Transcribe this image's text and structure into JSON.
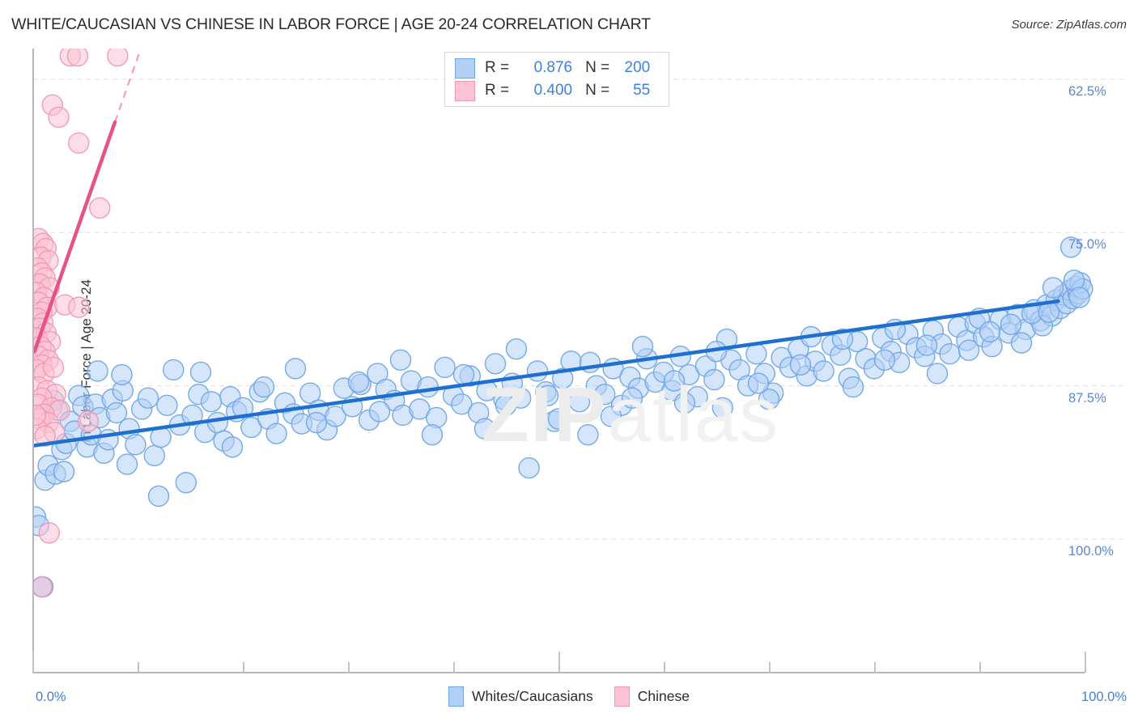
{
  "header": {
    "title": "WHITE/CAUCASIAN VS CHINESE IN LABOR FORCE | AGE 20-24 CORRELATION CHART",
    "source": "Source: ZipAtlas.com"
  },
  "watermark": {
    "part1": "ZIP",
    "part2": "atlas"
  },
  "legend": {
    "rows": [
      {
        "swatch": "blue",
        "r_key": "R =",
        "r_value": "0.876",
        "n_key": "N =",
        "n_value": "200"
      },
      {
        "swatch": "pink",
        "r_key": "R =",
        "r_value": "0.400",
        "n_key": "N =",
        "n_value": "55"
      }
    ]
  },
  "bottom_legend": {
    "items": [
      {
        "swatch": "blue",
        "label": "Whites/Caucasians"
      },
      {
        "swatch": "pink",
        "label": "Chinese"
      }
    ]
  },
  "axes": {
    "ylabel": "In Labor Force | Age 20-24",
    "y_ticks": [
      "100.0%",
      "87.5%",
      "75.0%",
      "62.5%"
    ],
    "x_start": "0.0%",
    "x_end": "100.0%"
  },
  "colors": {
    "blue_fill": "#b2cff6",
    "blue_stroke": "#6fa5e8",
    "blue_line": "#1f6fd0",
    "pink_fill": "#fcc3d4",
    "pink_stroke": "#f297b4",
    "pink_line": "#e8508a",
    "axis": "#b6b6b6",
    "grid": "#e3dede",
    "tick_text": "#3f7fe0",
    "title_text": "#2b2b2b"
  },
  "chart_data": {
    "type": "scatter",
    "title": "WHITE/CAUCASIAN VS CHINESE IN LABOR FORCE | AGE 20-24 CORRELATION CHART",
    "xlabel": "",
    "ylabel": "In Labor Force | Age 20-24",
    "xlim": [
      0,
      100
    ],
    "ylim": [
      52.0,
      102.5
    ],
    "x_ticks": [
      0,
      10,
      20,
      30,
      40,
      50,
      60,
      70,
      80,
      90,
      100
    ],
    "y_ticks": [
      62.5,
      75.0,
      87.5,
      100.0
    ],
    "grid": "horizontal-dashed",
    "legend_position": "top-center-box",
    "series": [
      {
        "name": "Whites/Caucasians",
        "color": "#b2cff6",
        "r": 0.876,
        "n": 200,
        "trendline": {
          "x0": 0,
          "y0": 70.1,
          "x1": 97.5,
          "y1": 81.9,
          "color": "#1f6fd0"
        },
        "points": [
          [
            0.3,
            64.3
          ],
          [
            0.6,
            63.6
          ],
          [
            0.9,
            58.6
          ],
          [
            1.2,
            67.3
          ],
          [
            1.5,
            68.5
          ],
          [
            2.0,
            73.8
          ],
          [
            2.4,
            73.0
          ],
          [
            2.8,
            69.8
          ],
          [
            3.2,
            70.3
          ],
          [
            3.6,
            72.1
          ],
          [
            4.0,
            71.3
          ],
          [
            4.4,
            74.2
          ],
          [
            4.8,
            73.3
          ],
          [
            5.2,
            70.0
          ],
          [
            5.6,
            71.0
          ],
          [
            6.0,
            73.5
          ],
          [
            6.4,
            72.4
          ],
          [
            6.8,
            69.5
          ],
          [
            7.2,
            70.6
          ],
          [
            7.6,
            73.9
          ],
          [
            8.0,
            72.8
          ],
          [
            8.6,
            74.6
          ],
          [
            9.2,
            71.5
          ],
          [
            9.8,
            70.2
          ],
          [
            10.4,
            73.1
          ],
          [
            11.0,
            74.0
          ],
          [
            11.6,
            69.3
          ],
          [
            12.2,
            70.8
          ],
          [
            12.8,
            73.4
          ],
          [
            13.4,
            76.3
          ],
          [
            14.0,
            71.8
          ],
          [
            14.6,
            67.1
          ],
          [
            15.2,
            72.6
          ],
          [
            15.8,
            74.3
          ],
          [
            16.4,
            71.2
          ],
          [
            17.0,
            73.7
          ],
          [
            17.6,
            72.0
          ],
          [
            18.2,
            70.5
          ],
          [
            18.8,
            74.1
          ],
          [
            19.4,
            72.9
          ],
          [
            20.0,
            73.2
          ],
          [
            20.8,
            71.6
          ],
          [
            21.6,
            74.5
          ],
          [
            22.4,
            72.3
          ],
          [
            23.2,
            71.1
          ],
          [
            24.0,
            73.6
          ],
          [
            24.8,
            72.7
          ],
          [
            25.6,
            71.9
          ],
          [
            26.4,
            74.4
          ],
          [
            27.2,
            73.0
          ],
          [
            28.0,
            71.4
          ],
          [
            28.8,
            72.5
          ],
          [
            29.6,
            74.8
          ],
          [
            30.4,
            73.3
          ],
          [
            31.2,
            75.1
          ],
          [
            32.0,
            72.2
          ],
          [
            32.8,
            76.0
          ],
          [
            33.6,
            74.7
          ],
          [
            34.4,
            73.8
          ],
          [
            35.2,
            72.6
          ],
          [
            36.0,
            75.4
          ],
          [
            36.8,
            73.1
          ],
          [
            37.6,
            74.9
          ],
          [
            38.4,
            72.4
          ],
          [
            39.2,
            76.5
          ],
          [
            40.0,
            74.2
          ],
          [
            40.8,
            73.5
          ],
          [
            41.6,
            75.8
          ],
          [
            42.4,
            72.8
          ],
          [
            43.2,
            74.6
          ],
          [
            44.0,
            76.8
          ],
          [
            44.8,
            73.9
          ],
          [
            45.6,
            75.2
          ],
          [
            46.4,
            74.0
          ],
          [
            47.2,
            68.3
          ],
          [
            48.0,
            76.2
          ],
          [
            48.8,
            74.5
          ],
          [
            49.6,
            72.1
          ],
          [
            50.4,
            75.6
          ],
          [
            51.2,
            77.0
          ],
          [
            52.0,
            73.7
          ],
          [
            52.8,
            71.0
          ],
          [
            53.6,
            75.0
          ],
          [
            54.4,
            74.3
          ],
          [
            55.2,
            76.4
          ],
          [
            56.0,
            73.4
          ],
          [
            56.8,
            75.7
          ],
          [
            57.6,
            74.8
          ],
          [
            58.4,
            77.2
          ],
          [
            59.2,
            75.3
          ],
          [
            60.0,
            76.1
          ],
          [
            60.8,
            74.6
          ],
          [
            61.6,
            77.4
          ],
          [
            62.4,
            75.9
          ],
          [
            63.2,
            74.1
          ],
          [
            64.0,
            76.6
          ],
          [
            64.8,
            75.5
          ],
          [
            65.6,
            73.2
          ],
          [
            66.4,
            77.1
          ],
          [
            67.2,
            76.3
          ],
          [
            68.0,
            75.0
          ],
          [
            68.8,
            77.6
          ],
          [
            69.6,
            76.0
          ],
          [
            70.4,
            74.4
          ],
          [
            71.2,
            77.3
          ],
          [
            72.0,
            76.5
          ],
          [
            72.8,
            78.0
          ],
          [
            73.6,
            75.8
          ],
          [
            74.4,
            77.0
          ],
          [
            75.2,
            76.2
          ],
          [
            76.0,
            78.3
          ],
          [
            76.8,
            77.5
          ],
          [
            77.6,
            75.6
          ],
          [
            78.4,
            78.6
          ],
          [
            79.2,
            77.2
          ],
          [
            80.0,
            76.4
          ],
          [
            80.8,
            78.9
          ],
          [
            81.6,
            77.8
          ],
          [
            82.4,
            76.9
          ],
          [
            83.2,
            79.2
          ],
          [
            84.0,
            78.1
          ],
          [
            84.8,
            77.4
          ],
          [
            85.6,
            79.5
          ],
          [
            86.4,
            78.4
          ],
          [
            87.2,
            77.6
          ],
          [
            88.0,
            79.8
          ],
          [
            88.8,
            78.7
          ],
          [
            89.6,
            80.1
          ],
          [
            90.4,
            79.0
          ],
          [
            91.2,
            78.2
          ],
          [
            92.0,
            80.4
          ],
          [
            92.8,
            79.3
          ],
          [
            93.6,
            80.8
          ],
          [
            94.4,
            79.6
          ],
          [
            95.2,
            81.2
          ],
          [
            95.8,
            80.3
          ],
          [
            96.4,
            81.6
          ],
          [
            96.9,
            80.7
          ],
          [
            97.3,
            82.0
          ],
          [
            97.7,
            81.3
          ],
          [
            98.0,
            82.4
          ],
          [
            98.3,
            81.7
          ],
          [
            98.6,
            82.8
          ],
          [
            98.9,
            82.1
          ],
          [
            99.2,
            83.1
          ],
          [
            99.4,
            82.5
          ],
          [
            99.6,
            83.4
          ],
          [
            99.8,
            82.9
          ],
          [
            98.7,
            86.3
          ],
          [
            8.5,
            75.9
          ],
          [
            12.0,
            66.0
          ],
          [
            25.0,
            76.4
          ],
          [
            2.2,
            67.8
          ],
          [
            3.0,
            68.0
          ],
          [
            1.0,
            58.6
          ],
          [
            35.0,
            77.1
          ],
          [
            38.0,
            71.0
          ],
          [
            43.0,
            71.5
          ],
          [
            46.0,
            78.0
          ],
          [
            50.0,
            72.3
          ],
          [
            55.0,
            72.5
          ],
          [
            58.0,
            78.2
          ],
          [
            62.0,
            73.6
          ],
          [
            66.0,
            78.8
          ],
          [
            70.0,
            73.9
          ],
          [
            74.0,
            79.0
          ],
          [
            78.0,
            74.9
          ],
          [
            82.0,
            79.6
          ],
          [
            86.0,
            76.0
          ],
          [
            90.0,
            80.5
          ],
          [
            94.0,
            78.5
          ],
          [
            96.0,
            79.9
          ],
          [
            97.0,
            83.0
          ],
          [
            99.0,
            83.6
          ],
          [
            99.5,
            82.2
          ],
          [
            6.2,
            76.2
          ],
          [
            9.0,
            68.6
          ],
          [
            16.0,
            76.1
          ],
          [
            19.0,
            70.0
          ],
          [
            22.0,
            74.9
          ],
          [
            27.0,
            72.0
          ],
          [
            31.0,
            75.3
          ],
          [
            33.0,
            72.9
          ],
          [
            41.0,
            75.9
          ],
          [
            45.0,
            73.4
          ],
          [
            49.0,
            74.2
          ],
          [
            53.0,
            76.9
          ],
          [
            57.0,
            74.0
          ],
          [
            61.0,
            75.4
          ],
          [
            65.0,
            77.8
          ],
          [
            69.0,
            75.2
          ],
          [
            73.0,
            76.7
          ],
          [
            77.0,
            78.8
          ],
          [
            81.0,
            77.1
          ],
          [
            85.0,
            78.3
          ],
          [
            89.0,
            77.9
          ],
          [
            91.0,
            79.4
          ],
          [
            93.0,
            80.0
          ],
          [
            95.0,
            80.9
          ],
          [
            96.6,
            81.0
          ]
        ]
      },
      {
        "name": "Chinese",
        "color": "#fcc3d4",
        "r": 0.4,
        "n": 55,
        "trendline": {
          "x0": 0.2,
          "y0": 77.8,
          "x1": 10.3,
          "y1": 102.5,
          "color": "#e8508a",
          "dashed_above": 96.5
        },
        "points": [
          [
            3.6,
            101.9
          ],
          [
            4.3,
            101.9
          ],
          [
            8.1,
            101.9
          ],
          [
            1.9,
            97.9
          ],
          [
            2.5,
            96.9
          ],
          [
            4.4,
            94.8
          ],
          [
            6.4,
            89.5
          ],
          [
            0.6,
            87.0
          ],
          [
            1.0,
            86.6
          ],
          [
            1.3,
            86.2
          ],
          [
            0.8,
            85.5
          ],
          [
            1.5,
            85.2
          ],
          [
            0.5,
            84.6
          ],
          [
            0.9,
            84.2
          ],
          [
            1.2,
            83.8
          ],
          [
            0.7,
            83.3
          ],
          [
            1.6,
            83.0
          ],
          [
            0.4,
            82.6
          ],
          [
            1.1,
            82.2
          ],
          [
            0.6,
            81.8
          ],
          [
            1.4,
            81.4
          ],
          [
            0.9,
            81.0
          ],
          [
            3.1,
            81.6
          ],
          [
            4.4,
            81.4
          ],
          [
            0.5,
            80.5
          ],
          [
            1.0,
            80.1
          ],
          [
            0.7,
            79.7
          ],
          [
            1.3,
            79.3
          ],
          [
            0.4,
            78.9
          ],
          [
            1.7,
            78.6
          ],
          [
            0.8,
            78.2
          ],
          [
            1.2,
            77.8
          ],
          [
            0.6,
            77.4
          ],
          [
            1.5,
            77.1
          ],
          [
            0.9,
            76.7
          ],
          [
            0.4,
            76.3
          ],
          [
            1.1,
            76.0
          ],
          [
            2.0,
            76.5
          ],
          [
            0.6,
            74.9
          ],
          [
            1.4,
            74.6
          ],
          [
            2.2,
            74.3
          ],
          [
            0.9,
            74.0
          ],
          [
            0.5,
            73.5
          ],
          [
            1.8,
            73.2
          ],
          [
            2.6,
            73.0
          ],
          [
            1.1,
            72.7
          ],
          [
            0.7,
            72.3
          ],
          [
            1.5,
            72.0
          ],
          [
            5.3,
            72.1
          ],
          [
            0.4,
            71.5
          ],
          [
            2.1,
            71.2
          ],
          [
            1.2,
            70.9
          ],
          [
            1.6,
            63.0
          ],
          [
            0.9,
            58.6
          ],
          [
            0.3,
            72.6
          ]
        ]
      }
    ]
  }
}
